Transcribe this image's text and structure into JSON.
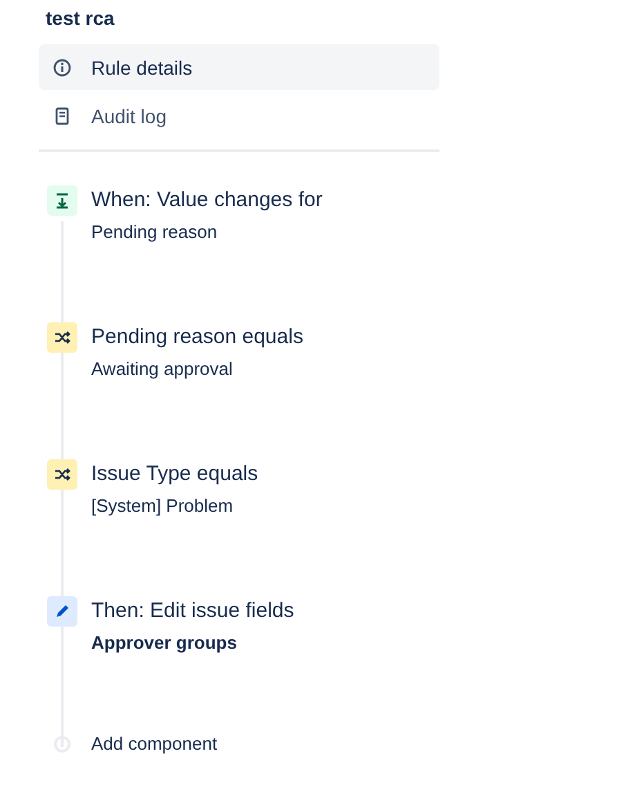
{
  "rule": {
    "title": "test rca"
  },
  "menu": [
    {
      "label": "Rule details",
      "kind": "info",
      "selected": true
    },
    {
      "label": "Audit log",
      "kind": "log",
      "selected": false
    }
  ],
  "steps": [
    {
      "kind": "trigger",
      "title": "When: Value changes for",
      "detail": "Pending reason"
    },
    {
      "kind": "condition",
      "title": "Pending reason equals",
      "detail": "Awaiting approval"
    },
    {
      "kind": "condition",
      "title": "Issue Type equals",
      "detail": "[System] Problem"
    },
    {
      "kind": "action",
      "title": "Then: Edit issue fields",
      "detail": "Approver groups"
    }
  ],
  "add_component": {
    "label": "Add component"
  }
}
